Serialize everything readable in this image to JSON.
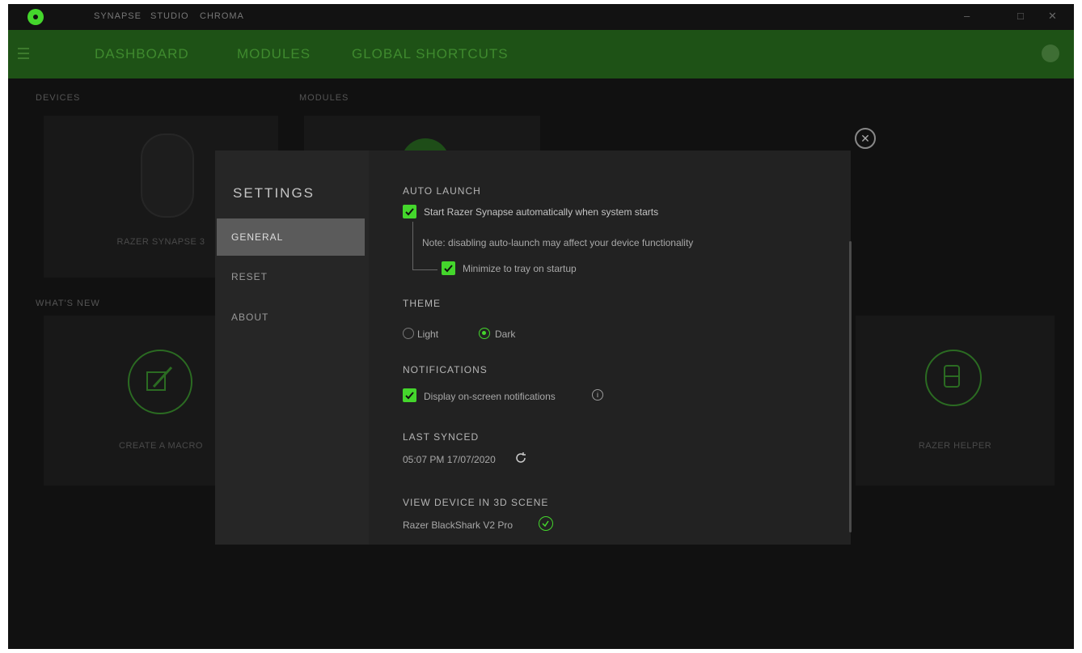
{
  "titlebar": {
    "tabs": [
      "SYNAPSE",
      "STUDIO",
      "CHROMA"
    ],
    "controls": [
      "–",
      "□",
      "✕"
    ]
  },
  "navbar": {
    "tabs": [
      "DASHBOARD",
      "MODULES",
      "GLOBAL SHORTCUTS"
    ]
  },
  "background": {
    "section_devices": "DEVICES",
    "section_modules": "MODULES",
    "section_recommended": "WHAT'S NEW",
    "card_left_label": "RAZER SYNAPSE 3",
    "card_bottom_left_label": "CREATE A MACRO",
    "card_bottom_right_label": "RAZER HELPER"
  },
  "settings": {
    "title": "SETTINGS",
    "nav": [
      "GENERAL",
      "RESET",
      "ABOUT"
    ],
    "auto_launch": {
      "heading": "AUTO LAUNCH",
      "option_label": "Start Razer Synapse automatically when system starts",
      "note": "Note: disabling auto-launch may affect your device functionality",
      "sub_option_label": "Minimize to tray on startup"
    },
    "theme": {
      "heading": "THEME",
      "options": [
        "Light",
        "Dark"
      ],
      "selected": "Dark"
    },
    "notifications": {
      "heading": "NOTIFICATIONS",
      "option_label": "Display on-screen notifications"
    },
    "last_synced": {
      "heading": "LAST SYNCED",
      "value": "05:07 PM 17/07/2020"
    },
    "view_device": {
      "heading": "VIEW DEVICE IN 3D SCENE",
      "value": "Razer BlackShark V2 Pro"
    }
  },
  "colors": {
    "accent": "#44d62c",
    "nav_bar": "#1e5216",
    "modal": "#222222"
  }
}
